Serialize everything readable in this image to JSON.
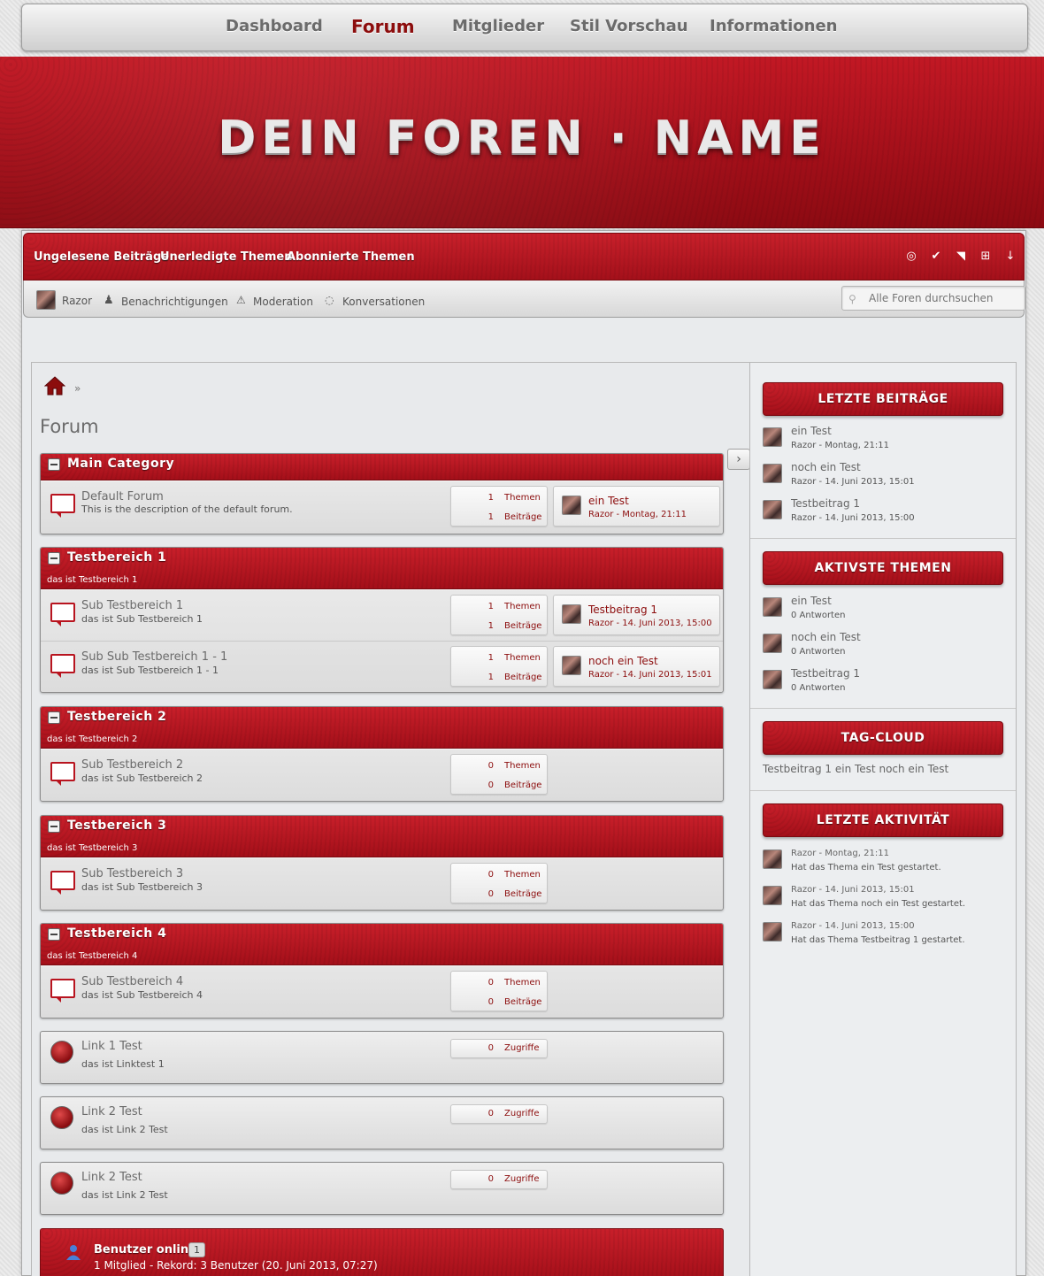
{
  "topnav": {
    "items": [
      "Dashboard",
      "Forum",
      "Mitglieder",
      "Stil Vorschau",
      "Informationen"
    ],
    "active": "Forum"
  },
  "banner": {
    "logo_text": "DEIN FOREN · NAME"
  },
  "rednav": {
    "links": [
      "Ungelesene Beiträge",
      "Unerledigte Themen",
      "Abonnierte Themen"
    ],
    "icons": [
      "mark-read-icon",
      "check-icon",
      "rss-icon",
      "sitemap-icon",
      "arrow-down-icon"
    ]
  },
  "usernav": {
    "username": "Razor",
    "notifications": "Benachrichtigungen",
    "moderation": "Moderation",
    "conversations": "Konversationen",
    "search_placeholder": "Alle Foren durchsuchen"
  },
  "breadcrumb": {
    "separator": "»"
  },
  "page_title": "Forum",
  "categories": [
    {
      "title": "Main Category",
      "desc": "",
      "boards": [
        {
          "title": "Default Forum",
          "desc": "This is the description of the default forum.",
          "themen": "1",
          "beitraege": "1",
          "last_title": "ein Test",
          "last_meta": "Razor - Montag, 21:11"
        }
      ]
    },
    {
      "title": "Testbereich 1",
      "desc": "das ist Testbereich 1",
      "boards": [
        {
          "title": "Sub Testbereich 1",
          "desc": "das ist Sub Testbereich 1",
          "themen": "1",
          "beitraege": "1",
          "last_title": "Testbeitrag 1",
          "last_meta": "Razor - 14. Juni 2013, 15:00"
        },
        {
          "title": "Sub Sub Testbereich 1 - 1",
          "desc": "das ist Sub Testbereich 1 - 1",
          "themen": "1",
          "beitraege": "1",
          "last_title": "noch ein Test",
          "last_meta": "Razor - 14. Juni 2013, 15:01"
        }
      ]
    },
    {
      "title": "Testbereich 2",
      "desc": "das ist Testbereich 2",
      "boards": [
        {
          "title": "Sub Testbereich 2",
          "desc": "das ist Sub Testbereich 2",
          "themen": "0",
          "beitraege": "0"
        }
      ]
    },
    {
      "title": "Testbereich 3",
      "desc": "das ist Testbereich 3",
      "boards": [
        {
          "title": "Sub Testbereich 3",
          "desc": "das ist Sub Testbereich 3",
          "themen": "0",
          "beitraege": "0"
        }
      ]
    },
    {
      "title": "Testbereich 4",
      "desc": "das ist Testbereich 4",
      "boards": [
        {
          "title": "Sub Testbereich 4",
          "desc": "das ist Sub Testbereich 4",
          "themen": "0",
          "beitraege": "0"
        }
      ]
    }
  ],
  "labels": {
    "themen": "Themen",
    "beitraege": "Beiträge",
    "zugriffe": "Zugriffe"
  },
  "links": [
    {
      "title": "Link 1 Test",
      "desc": "das ist Linktest 1",
      "zugriffe": "0"
    },
    {
      "title": "Link 2 Test",
      "desc": "das ist Link 2 Test",
      "zugriffe": "0"
    },
    {
      "title": "Link 2 Test",
      "desc": "das ist Link 2 Test",
      "zugriffe": "0"
    }
  ],
  "online": {
    "title": "Benutzer online",
    "count": "1",
    "record": "1 Mitglied - Rekord: 3 Benutzer (20. Juni 2013, 07:27)"
  },
  "sidebar": {
    "latest_posts": {
      "title": "LETZTE BEITRÄGE",
      "items": [
        {
          "title": "ein Test",
          "meta": "Razor - Montag, 21:11"
        },
        {
          "title": "noch ein Test",
          "meta": "Razor - 14. Juni 2013, 15:01"
        },
        {
          "title": "Testbeitrag 1",
          "meta": "Razor - 14. Juni 2013, 15:00"
        }
      ]
    },
    "active_topics": {
      "title": "AKTIVSTE THEMEN",
      "items": [
        {
          "title": "ein Test",
          "meta": "0 Antworten"
        },
        {
          "title": "noch ein Test",
          "meta": "0 Antworten"
        },
        {
          "title": "Testbeitrag 1",
          "meta": "0 Antworten"
        }
      ]
    },
    "tag_cloud": {
      "title": "TAG-CLOUD",
      "tags": [
        "Testbeitrag 1",
        "ein Test",
        "noch ein Test"
      ]
    },
    "latest_activity": {
      "title": "LETZTE AKTIVITÄT",
      "items": [
        {
          "meta": "Razor - Montag, 21:11",
          "text": "Hat das Thema ein Test gestartet."
        },
        {
          "meta": "Razor - 14. Juni 2013, 15:01",
          "text": "Hat das Thema noch ein Test gestartet."
        },
        {
          "meta": "Razor - 14. Juni 2013, 15:00",
          "text": "Hat das Thema Testbeitrag 1 gestartet."
        }
      ]
    }
  },
  "colors": {
    "accent_red": "#b8141f",
    "link_red": "#8c0d0d"
  }
}
